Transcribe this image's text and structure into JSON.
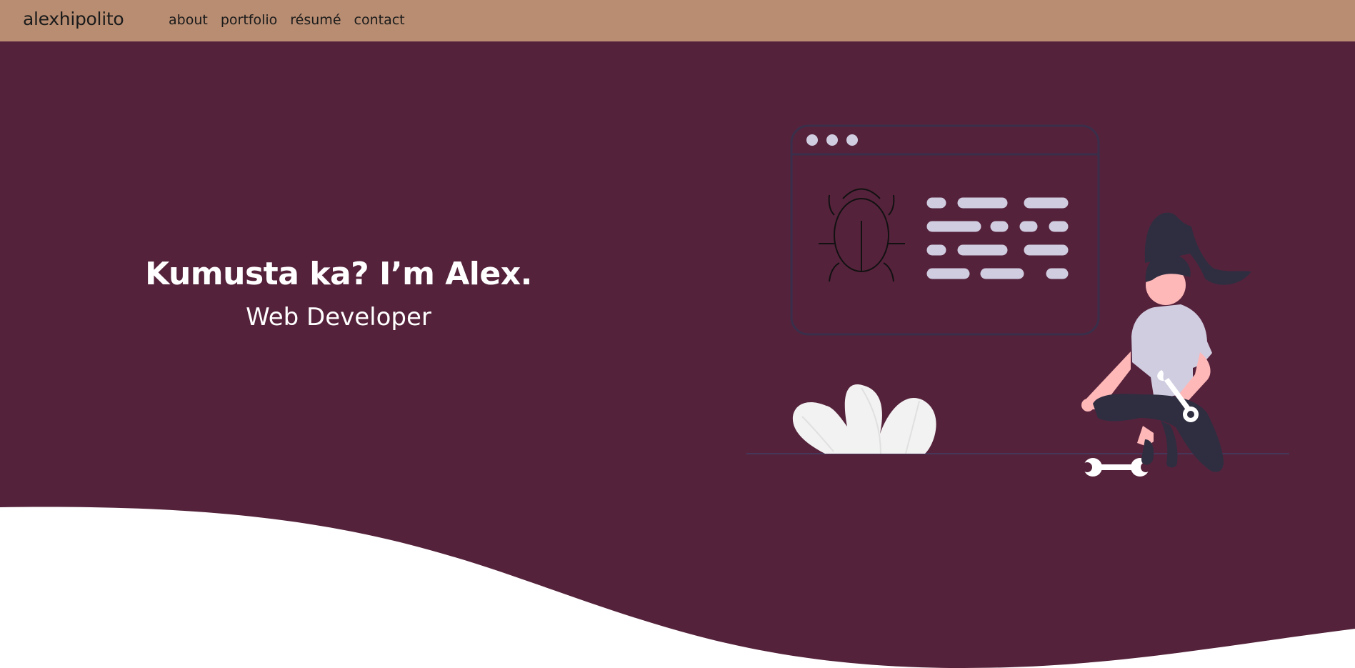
{
  "navbar": {
    "brand": "alexhipolito",
    "links": [
      {
        "label": "about"
      },
      {
        "label": "portfolio"
      },
      {
        "label": "résumé"
      },
      {
        "label": "contact"
      }
    ]
  },
  "hero": {
    "title": "Kumusta ka? I’m Alex.",
    "subtitle": "Web Developer"
  },
  "colors": {
    "navbar_bg": "#b88d72",
    "hero_bg": "#55223b",
    "accent_skin": "#ffb8b8",
    "dark": "#2f2e41",
    "light": "#d0cde1"
  },
  "icons": [
    "bug-icon",
    "wrench-icon"
  ]
}
